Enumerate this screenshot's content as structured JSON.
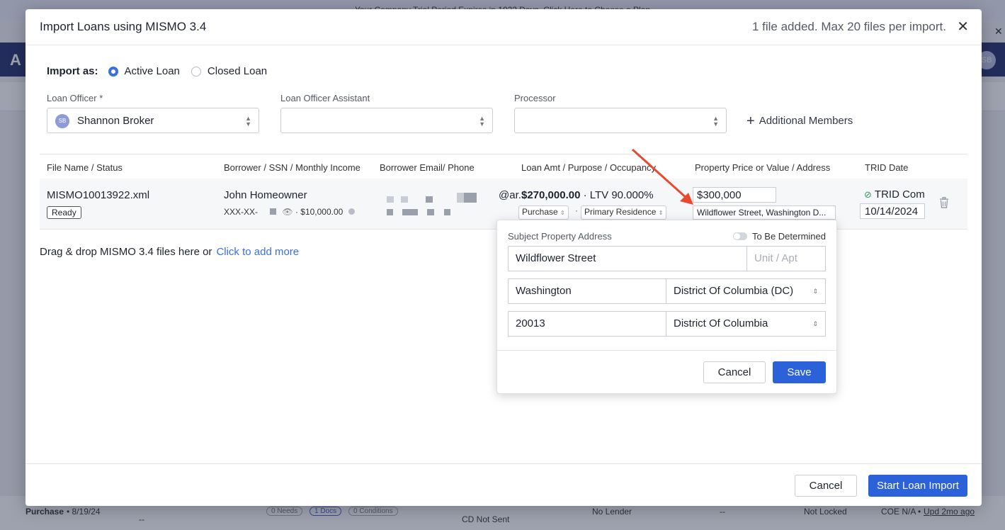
{
  "background": {
    "banner_text": "Your Company Trial Period Expires in 1022 Days. Click Here to Choose a Plan",
    "logo_letter": "A",
    "avatar_initials": "SB",
    "row": {
      "purpose": "Purchase",
      "date": "• 8/19/24",
      "dash1": "--",
      "needs": "0 Needs",
      "docs": "1 Docs",
      "conditions": "0 Conditions",
      "cd_status": "CD Not Sent",
      "lender": "No Lender",
      "dash2": "--",
      "lock": "Not Locked",
      "coe": "COE N/A • ",
      "updated": "Upd 2mo ago"
    }
  },
  "modal": {
    "title": "Import Loans using MISMO 3.4",
    "status": "1 file added. Max 20 files per import.",
    "import_as": {
      "label": "Import as:",
      "options": [
        "Active Loan",
        "Closed Loan"
      ],
      "selected": "Active Loan"
    },
    "loan_officer": {
      "label": "Loan Officer *",
      "value": "Shannon Broker",
      "initials": "SB"
    },
    "loan_officer_assistant": {
      "label": "Loan Officer Assistant",
      "value": ""
    },
    "processor": {
      "label": "Processor",
      "value": ""
    },
    "additional_members": "Additional Members",
    "table": {
      "headers": [
        "File Name / Status",
        "Borrower / SSN / Monthly Income",
        "Borrower Email/ Phone",
        "Loan Amt / Purpose / Occupancy",
        "Property Price or Value / Address",
        "TRID Date"
      ],
      "row": {
        "file_name": "MISMO10013922.xml",
        "status": "Ready",
        "borrower": "John Homeowner",
        "ssn_prefix": "XXX-XX-",
        "income": "· $10,000.00",
        "email_suffix": "@ar...",
        "loan_amount": "$270,000.00",
        "ltv": "· LTV 90.000%",
        "purpose": "Purchase",
        "occupancy": "Primary Residence",
        "price": "$300,000",
        "address": "Wildflower Street, Washington D...",
        "trid_status": "TRID Comp",
        "trid_date": "10/14/2024"
      }
    },
    "drop_text": "Drag & drop MISMO 3.4 files here or",
    "drop_link": "Click to add more",
    "footer": {
      "cancel": "Cancel",
      "start": "Start Loan Import"
    }
  },
  "popover": {
    "title": "Subject Property Address",
    "tbd_label": "To Be Determined",
    "street": "Wildflower Street",
    "unit_placeholder": "Unit / Apt",
    "city": "Washington",
    "state": "District Of Columbia (DC)",
    "zip": "20013",
    "county": "District Of Columbia",
    "cancel": "Cancel",
    "save": "Save"
  },
  "colors": {
    "primary": "#2c62d9",
    "link": "#3b6fe0",
    "annotation_arrow": "#e8492f",
    "success": "#2f9e5a"
  }
}
